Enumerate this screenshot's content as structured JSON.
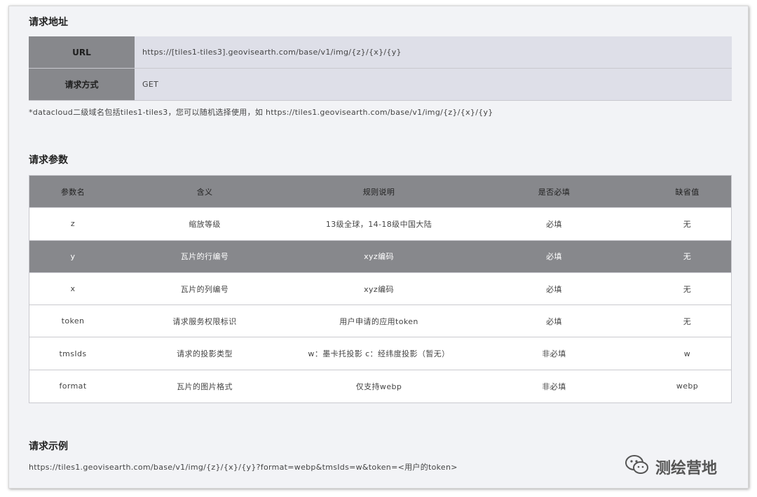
{
  "sections": {
    "address_title": "请求地址",
    "params_title": "请求参数",
    "example_title": "请求示例"
  },
  "request": {
    "url_key": "URL",
    "url_value": "https://[tiles1-tiles3].geovisearth.com/base/v1/img/{z}/{x}/{y}",
    "method_key": "请求方式",
    "method_value": "GET"
  },
  "note": "*datacloud二级域名包括tiles1-tiles3，您可以随机选择使用，如 https://tiles1.geovisearth.com/base/v1/img/{z}/{x}/{y}",
  "params_table": {
    "headers": [
      "参数名",
      "含义",
      "规则说明",
      "是否必填",
      "缺省值"
    ],
    "rows": [
      [
        "z",
        "缩放等级",
        "13级全球，14-18级中国大陆",
        "必填",
        "无"
      ],
      [
        "y",
        "瓦片的行编号",
        "xyz编码",
        "必填",
        "无"
      ],
      [
        "x",
        "瓦片的列编号",
        "xyz编码",
        "必填",
        "无"
      ],
      [
        "token",
        "请求服务权限标识",
        "用户申请的应用token",
        "必填",
        "无"
      ],
      [
        "tmsIds",
        "请求的投影类型",
        "w：墨卡托投影 c：经纬度投影（暂无）",
        "非必填",
        "w"
      ],
      [
        "format",
        "瓦片的图片格式",
        "仅支持webp",
        "非必填",
        "webp"
      ]
    ]
  },
  "example": "https://tiles1.geovisearth.com/base/v1/img/{z}/{x}/{y}?format=webp&tmsIds=w&token=<用户的token>",
  "watermark": {
    "text": "测绘营地",
    "icon": "wechat-icon"
  }
}
